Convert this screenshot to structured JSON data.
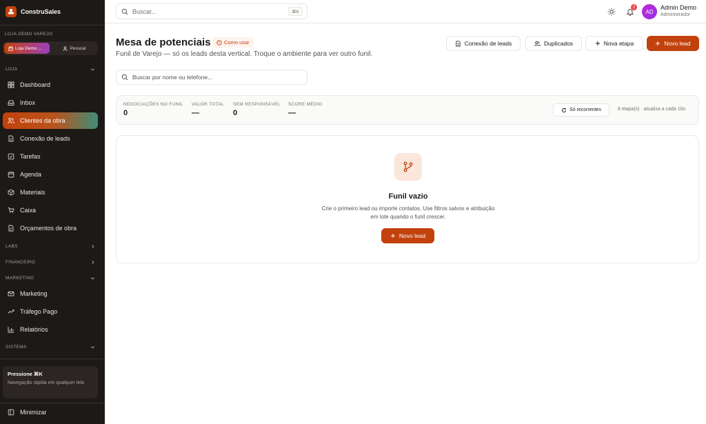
{
  "app": {
    "name": "ConstruSales"
  },
  "store": {
    "label": "LOJA DEMO VAREJO",
    "active": "Loja Demo ...",
    "other": "Pessoal"
  },
  "sidebar": {
    "sections": {
      "loja": "LOJA",
      "labs": "LABS",
      "financeiro": "FINANCEIRO",
      "marketing": "MARKETING",
      "sistema": "SISTEMA"
    },
    "items": [
      {
        "label": "Dashboard",
        "icon": "dashboard-icon"
      },
      {
        "label": "Inbox",
        "icon": "inbox-icon"
      },
      {
        "label": "Clientes da obra",
        "icon": "users-icon",
        "active": true
      },
      {
        "label": "Conexão de leads",
        "icon": "file-icon"
      },
      {
        "label": "Tarefas",
        "icon": "checkbox-icon"
      },
      {
        "label": "Agenda",
        "icon": "calendar-icon"
      },
      {
        "label": "Materiais",
        "icon": "package-icon"
      },
      {
        "label": "Caixa",
        "icon": "cart-icon"
      },
      {
        "label": "Orçamentos de obra",
        "icon": "document-icon"
      }
    ],
    "marketing_items": [
      {
        "label": "Marketing",
        "icon": "mail-icon"
      },
      {
        "label": "Tráfego Pago",
        "icon": "trending-icon"
      },
      {
        "label": "Relatórios",
        "icon": "bar-chart-icon"
      }
    ],
    "tip": {
      "title": "Pressione ⌘K",
      "text": "Navegação rápida em qualquer tela"
    },
    "minimize": "Minimizar"
  },
  "topbar": {
    "search_placeholder": "Buscar...",
    "shortcut": "⌘K",
    "notifications": "2",
    "user": {
      "initials": "AD",
      "name": "Admin Demo",
      "role": "Administrador"
    }
  },
  "page": {
    "title": "Mesa de potenciais",
    "howto": "Como usar",
    "subtitle": "Funil de Varejo — só os leads desta vertical. Troque o ambiente para ver outro funil.",
    "buttons": {
      "connect": "Conexão de leads",
      "duplicates": "Duplicados",
      "new_stage": "Nova etapa",
      "new_lead": "Novo lead"
    },
    "search_placeholder": "Buscar por nome ou telefone...",
    "stats": [
      {
        "label": "NEGOCIAÇÕES NO FUNIL",
        "value": "0"
      },
      {
        "label": "VALOR TOTAL",
        "value": "—"
      },
      {
        "label": "SEM RESPONSÁVEL",
        "value": "0"
      },
      {
        "label": "SCORE MÉDIO",
        "value": "—"
      }
    ],
    "recurring": "Só recorrentes",
    "stages_info": "8 etapa(s) · atualiza a cada 10s",
    "empty": {
      "title": "Funil vazio",
      "description": "Crie o primeiro lead ou importe contatos. Use filtros salvos e atribuição em lote quando o funil crescer.",
      "button": "Novo lead"
    }
  },
  "colors": {
    "accent": "#c2410c",
    "sidebar_bg": "#1c1917",
    "avatar": "#a855f7",
    "badge": "#ef4444"
  }
}
